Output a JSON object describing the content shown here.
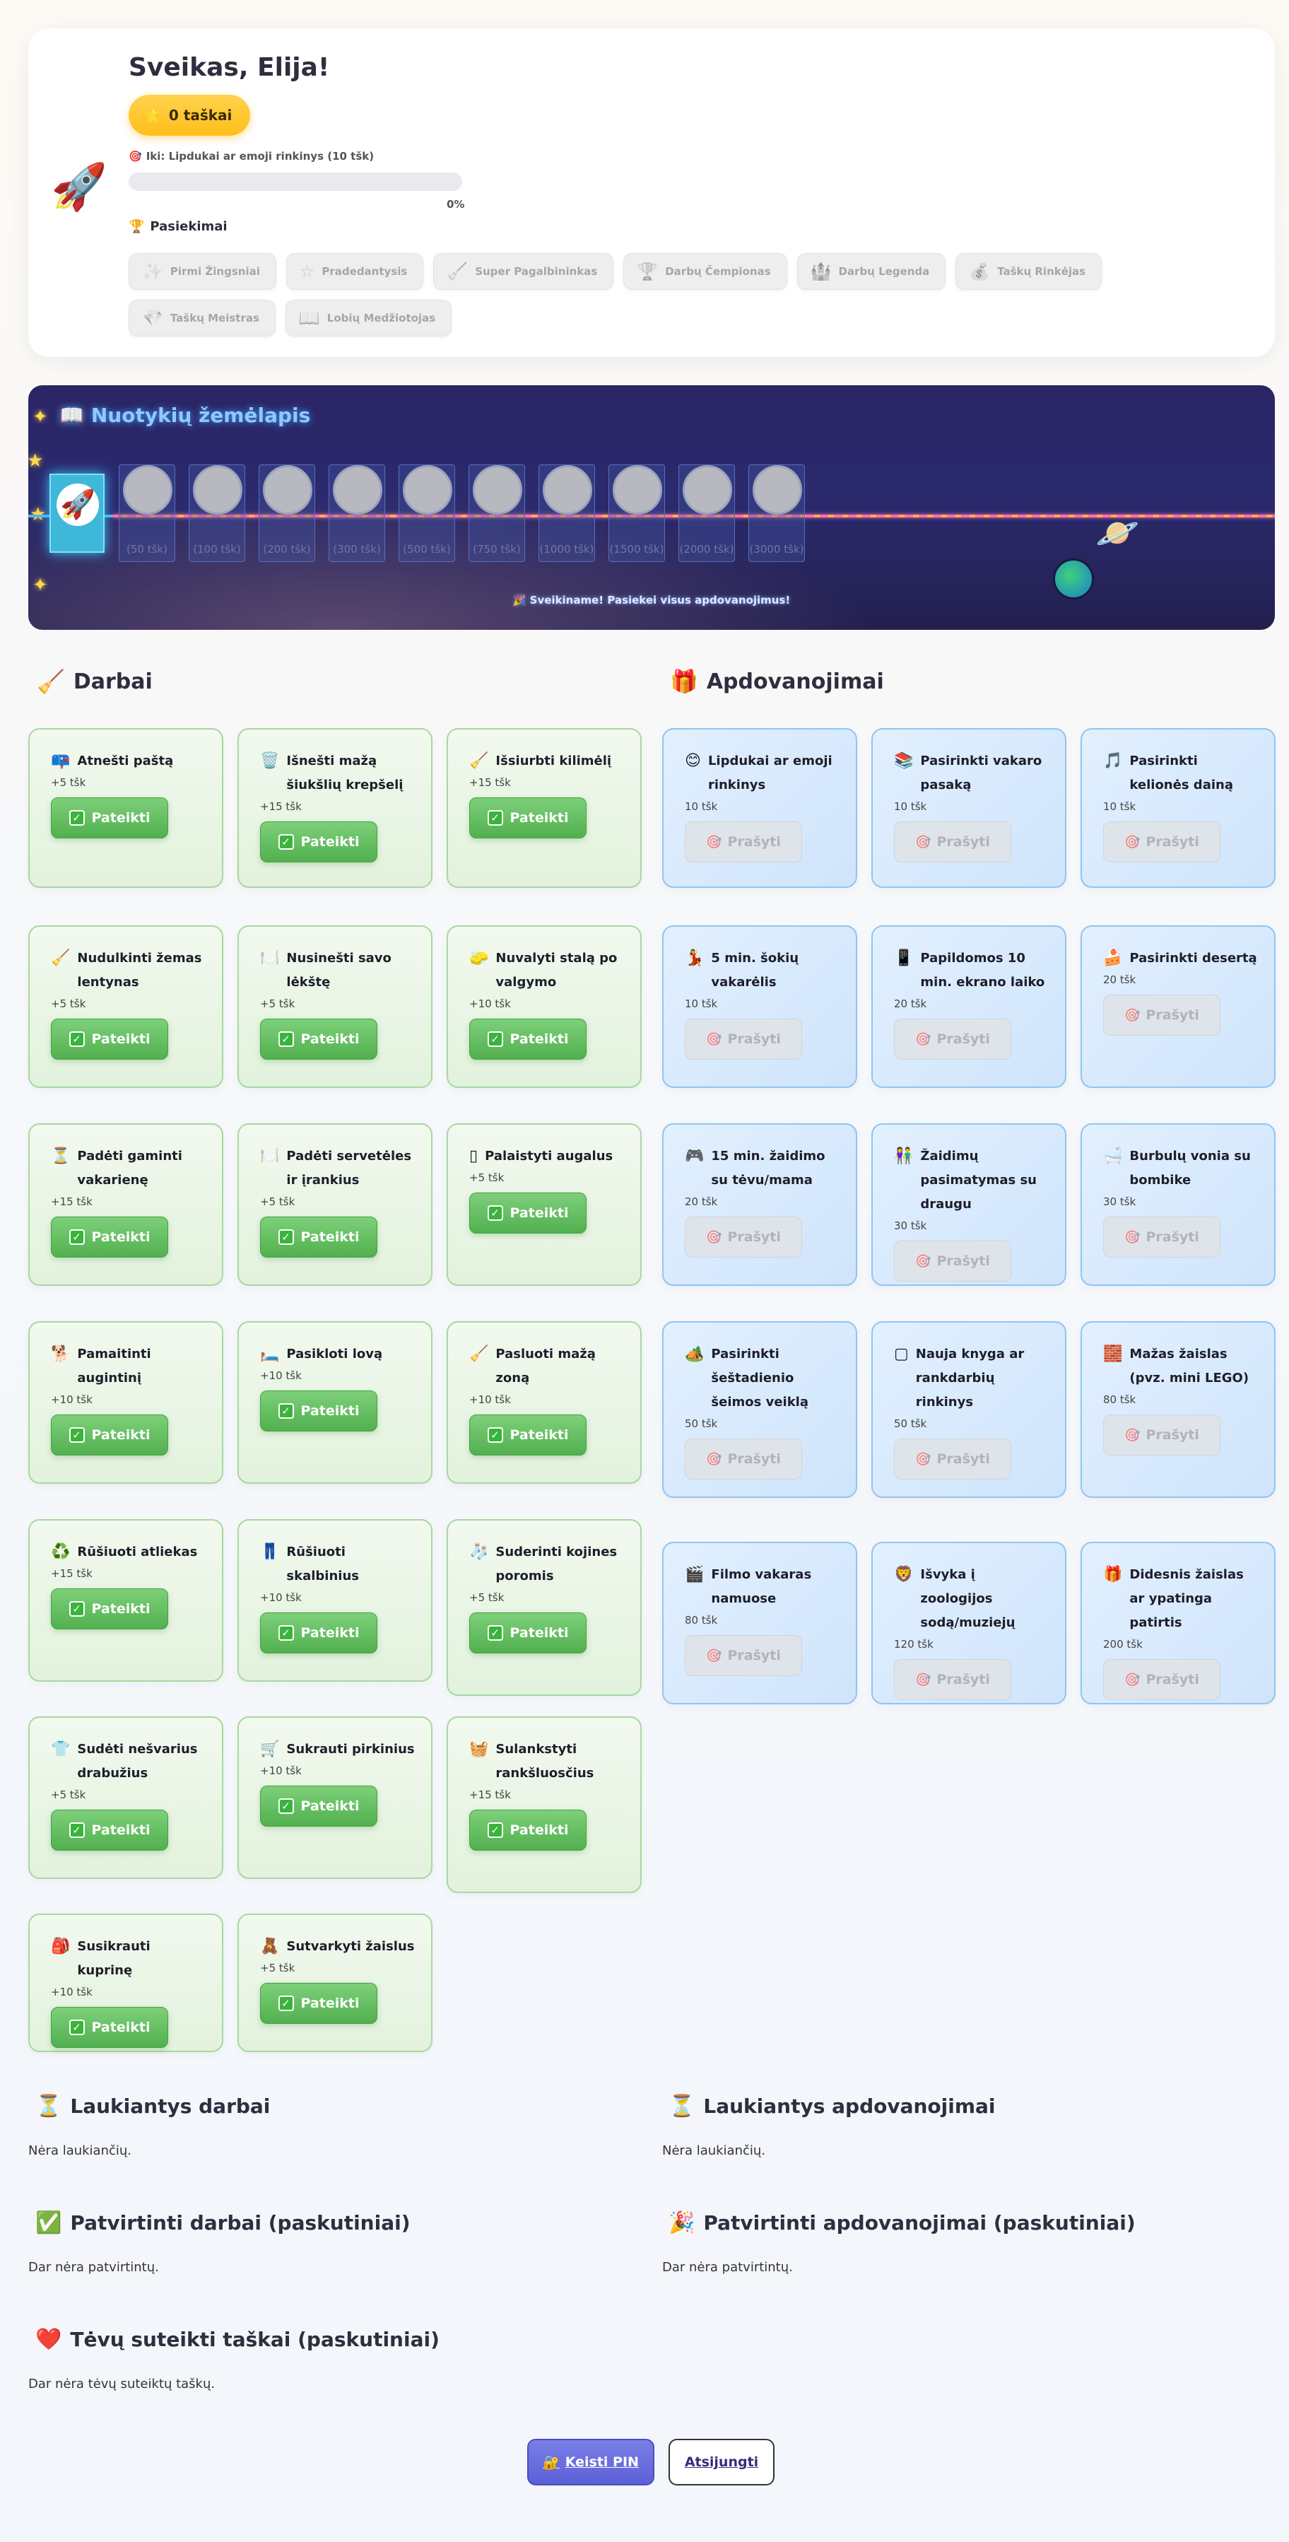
{
  "profile": {
    "greeting": "Sveikas, Elija!",
    "avatar_icon": "rocket-icon",
    "points_label": "0 taškai",
    "goal_label": "Iki: Lipdukai ar emoji rinkinys (10 tšk)",
    "progress_fraction": 0,
    "progress_pct": "0%",
    "achievements_title": "Pasiekimai",
    "achievements": [
      {
        "icon": "✨",
        "label": "Pirmi Žingsniai"
      },
      {
        "icon": "☆",
        "label": "Pradedantysis"
      },
      {
        "icon": "🧹",
        "label": "Super Pagalbininkas"
      },
      {
        "icon": "🏆",
        "label": "Darbų Čempionas"
      },
      {
        "icon": "🏰",
        "label": "Darbų Legenda"
      },
      {
        "icon": "💰",
        "label": "Taškų Rinkėjas"
      },
      {
        "icon": "💎",
        "label": "Taškų Meistras"
      },
      {
        "icon": "📖",
        "label": "Lobių Medžiotojas"
      }
    ]
  },
  "map": {
    "title": "Nuotykių žemėlapis",
    "milestones": [
      "(50 tšk)",
      "(100 tšk)",
      "(200 tšk)",
      "(300 tšk)",
      "(500 tšk)",
      "(750 tšk)",
      "(1000 tšk)",
      "(1500 tšk)",
      "(2000 tšk)",
      "(3000 tšk)"
    ],
    "congrats": "Sveikiname! Pasiekei visus apdovanojimus!"
  },
  "chores": {
    "title": "Darbai",
    "submit_label": "Pateikti",
    "items": [
      {
        "icon": "📪",
        "name": "Atnešti paštą",
        "points": "+5 tšk"
      },
      {
        "icon": "🗑️",
        "name": "Išnešti mažą šiukšlių krepšelį",
        "points": "+15 tšk"
      },
      {
        "icon": "🧹",
        "name": "Išsiurbti kilimėlį",
        "points": "+15 tšk"
      },
      {
        "icon": "🧹",
        "name": "Nudulkinti žemas lentynas",
        "points": "+5 tšk"
      },
      {
        "icon": "🍽️",
        "name": "Nusinešti savo lėkštę",
        "points": "+5 tšk"
      },
      {
        "icon": "🧽",
        "name": "Nuvalyti stalą po valgymo",
        "points": "+10 tšk"
      },
      {
        "icon": "⏳",
        "name": "Padėti gaminti vakarienę",
        "points": "+15 tšk"
      },
      {
        "icon": "🍽️",
        "name": "Padėti servetėles ir įrankius",
        "points": "+5 tšk"
      },
      {
        "icon": "▯",
        "name": "Palaistyti augalus",
        "points": "+5 tšk"
      },
      {
        "icon": "🐕",
        "name": "Pamaitinti augintinį",
        "points": "+10 tšk"
      },
      {
        "icon": "🛏️",
        "name": "Pasikloti lovą",
        "points": "+10 tšk"
      },
      {
        "icon": "🧹",
        "name": "Pasluoti mažą zoną",
        "points": "+10 tšk"
      },
      {
        "icon": "♻️",
        "name": "Rūšiuoti atliekas",
        "points": "+15 tšk"
      },
      {
        "icon": "👖",
        "name": "Rūšiuoti skalbinius",
        "points": "+10 tšk"
      },
      {
        "icon": "🧦",
        "name": "Suderinti kojines poromis",
        "points": "+5 tšk"
      },
      {
        "icon": "👕",
        "name": "Sudėti nešvarius drabužius",
        "points": "+5 tšk"
      },
      {
        "icon": "🛒",
        "name": "Sukrauti pirkinius",
        "points": "+10 tšk"
      },
      {
        "icon": "🧺",
        "name": "Sulankstyti rankšluosčius",
        "points": "+15 tšk"
      },
      {
        "icon": "🎒",
        "name": "Susikrauti kuprinę",
        "points": "+10 tšk"
      },
      {
        "icon": "🧸",
        "name": "Sutvarkyti žaislus",
        "points": "+5 tšk"
      }
    ]
  },
  "rewards": {
    "title": "Apdovanojimai",
    "ask_label": "Prašyti",
    "items": [
      {
        "icon": "😊",
        "name": "Lipdukai ar emoji rinkinys",
        "points": "10 tšk"
      },
      {
        "icon": "📚",
        "name": "Pasirinkti vakaro pasaką",
        "points": "10 tšk"
      },
      {
        "icon": "🎵",
        "name": "Pasirinkti kelionės dainą",
        "points": "10 tšk"
      },
      {
        "icon": "💃",
        "name": "5 min. šokių vakarėlis",
        "points": "10 tšk"
      },
      {
        "icon": "📱",
        "name": "Papildomos 10 min. ekrano laiko",
        "points": "20 tšk"
      },
      {
        "icon": "🍰",
        "name": "Pasirinkti desertą",
        "points": "20 tšk"
      },
      {
        "icon": "🎮",
        "name": "15 min. žaidimo su tėvu/mama",
        "points": "20 tšk"
      },
      {
        "icon": "👫",
        "name": "Žaidimų pasimatymas su draugu",
        "points": "30 tšk"
      },
      {
        "icon": "🛁",
        "name": "Burbulų vonia su bombike",
        "points": "30 tšk"
      },
      {
        "icon": "🏕️",
        "name": "Pasirinkti šeštadienio šeimos veiklą",
        "points": "50 tšk"
      },
      {
        "icon": "▢",
        "name": "Nauja knyga ar rankdarbių rinkinys",
        "points": "50 tšk"
      },
      {
        "icon": "🧱",
        "name": "Mažas žaislas (pvz. mini LEGO)",
        "points": "80 tšk"
      },
      {
        "icon": "🎬",
        "name": "Filmo vakaras namuose",
        "points": "80 tšk"
      },
      {
        "icon": "🦁",
        "name": "Išvyka į zoologijos sodą/muziejų",
        "points": "120 tšk"
      },
      {
        "icon": "🎁",
        "name": "Didesnis žaislas ar ypatinga patirtis",
        "points": "200 tšk"
      }
    ]
  },
  "pending_chores": {
    "title": "Laukiantys darbai",
    "empty": "Nėra laukiančių."
  },
  "pending_rewards": {
    "title": "Laukiantys apdovanojimai",
    "empty": "Nėra laukiančių."
  },
  "approved_chores": {
    "title": "Patvirtinti darbai (paskutiniai)",
    "empty": "Dar nėra patvirtintų."
  },
  "approved_rewards": {
    "title": "Patvirtinti apdovanojimai (paskutiniai)",
    "empty": "Dar nėra patvirtintų."
  },
  "parent_points": {
    "title": "Tėvų suteikti taškai (paskutiniai)",
    "empty": "Dar nėra tėvų suteiktų taškų."
  },
  "footer": {
    "change_pin": "Keisti PIN",
    "logout": "Atsijungti"
  }
}
